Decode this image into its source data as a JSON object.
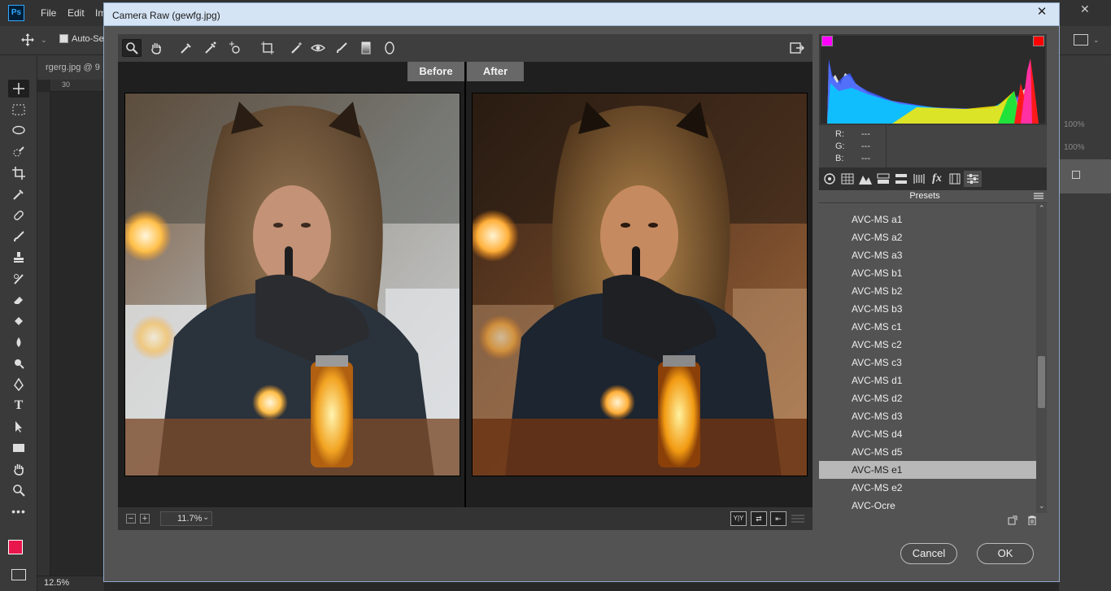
{
  "photoshop": {
    "logo": "Ps",
    "menu": [
      "File",
      "Edit",
      "Im"
    ],
    "options": {
      "auto_select_label": "Auto-Sel"
    },
    "doc_tab": "rgerg.jpg @ 9",
    "ruler_tick": "30",
    "status_zoom": "12.5%",
    "right_panel": {
      "zoom1": "100%",
      "zoom2": "100%"
    },
    "fg_color": "#e8164c",
    "bg_color": "#000000"
  },
  "dialog": {
    "title": "Camera Raw (gewfg.jpg)",
    "close_symbol": "✕"
  },
  "preview": {
    "before_label": "Before",
    "after_label": "After"
  },
  "bottom": {
    "zoom_value": "11.7%",
    "zoom_out": "−",
    "zoom_in": "+",
    "view_mode_label": "Y|Y"
  },
  "readout": {
    "r": "R:",
    "g": "G:",
    "b": "B:",
    "dash": "---"
  },
  "presets": {
    "header": "Presets",
    "items": [
      "AVC-MS a1",
      "AVC-MS a2",
      "AVC-MS a3",
      "AVC-MS b1",
      "AVC-MS b2",
      "AVC-MS b3",
      "AVC-MS c1",
      "AVC-MS c2",
      "AVC-MS c3",
      "AVC-MS d1",
      "AVC-MS d2",
      "AVC-MS d3",
      "AVC-MS d4",
      "AVC-MS d5",
      "AVC-MS e1",
      "AVC-MS e2",
      "AVC-Ocre"
    ],
    "selected_index": 14
  },
  "buttons": {
    "cancel": "Cancel",
    "ok": "OK"
  },
  "icons": {
    "toolbar": [
      "zoom-icon",
      "hand-icon",
      "white-balance-icon",
      "color-sampler-icon",
      "targeted-adjustment-icon",
      "crop-icon",
      "spot-removal-icon",
      "red-eye-icon",
      "adjustment-brush-icon",
      "graduated-filter-icon",
      "radial-filter-icon",
      "preferences-open-icon"
    ],
    "panel_tabs": [
      "basic-tab-icon",
      "tone-curve-tab-icon",
      "detail-tab-icon",
      "hsl-tab-icon",
      "split-toning-tab-icon",
      "lens-corrections-tab-icon",
      "effects-tab-icon",
      "camera-calibration-tab-icon",
      "presets-tab-icon"
    ]
  }
}
